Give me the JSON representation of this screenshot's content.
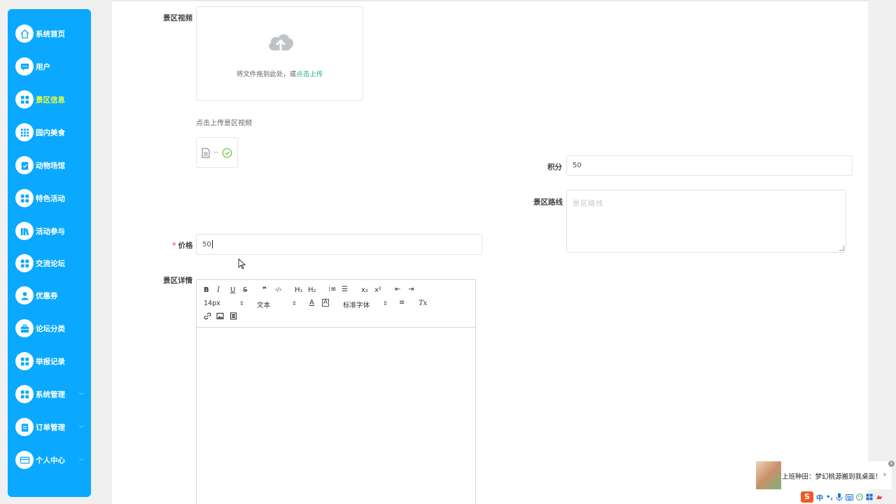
{
  "sidebar": {
    "items": [
      {
        "label": "系统首页",
        "icon": "home-icon"
      },
      {
        "label": "用户",
        "icon": "chat-icon"
      },
      {
        "label": "景区信息",
        "icon": "grid-icon",
        "active": true
      },
      {
        "label": "园内美食",
        "icon": "grid-dots-icon"
      },
      {
        "label": "动物场馆",
        "icon": "clipboard-check-icon"
      },
      {
        "label": "特色活动",
        "icon": "grid-icon"
      },
      {
        "label": "活动参与",
        "icon": "books-icon"
      },
      {
        "label": "交流论坛",
        "icon": "grid-icon"
      },
      {
        "label": "优惠券",
        "icon": "user-icon"
      },
      {
        "label": "论坛分类",
        "icon": "briefcase-icon"
      },
      {
        "label": "举报记录",
        "icon": "grid-icon"
      },
      {
        "label": "系统管理",
        "icon": "grid-icon",
        "expandable": true
      },
      {
        "label": "订单管理",
        "icon": "clipboard-icon",
        "expandable": true
      },
      {
        "label": "个人中心",
        "icon": "card-icon",
        "expandable": true
      }
    ],
    "active_color": "#e6ff3c",
    "bg_color": "#0aa9ff"
  },
  "form": {
    "video_label": "景区视频",
    "upload_text": "将文件拖到此处，或",
    "upload_link": "点击上传",
    "upload_tip": "点击上传景区视频",
    "file_ellipsis": "··",
    "points_label": "积分",
    "points_value": "50",
    "route_label": "景区路线",
    "route_placeholder": "景区路线",
    "price_required": "*",
    "price_label": "价格",
    "price_value": "50",
    "details_label": "景区详情"
  },
  "editor": {
    "bold": "B",
    "italic": "I",
    "underline": "U",
    "strike": "S",
    "quote": "❞",
    "code": "‹/›",
    "h1": "H₁",
    "h2": "H₂",
    "ordered_list": "⁝≡",
    "bullet_list": "☰",
    "subscript": "x₂",
    "superscript": "x²",
    "outdent": "⇤",
    "indent": "⇥",
    "size_value": "14px",
    "header_value": "文本",
    "color_btn": "A",
    "bg_btn": "A",
    "font_value": "标准字体",
    "align_btn": "≡",
    "clean_btn": "Tx",
    "link_icon": "link-icon",
    "image_icon": "image-icon",
    "video_icon": "video-icon"
  },
  "popup": {
    "text": "上班种田：梦幻桃源搬到我桌面！",
    "chevron": "›",
    "close": "×"
  },
  "tray": {
    "ime_logo": "S",
    "lang": "中",
    "punct": "•,"
  }
}
